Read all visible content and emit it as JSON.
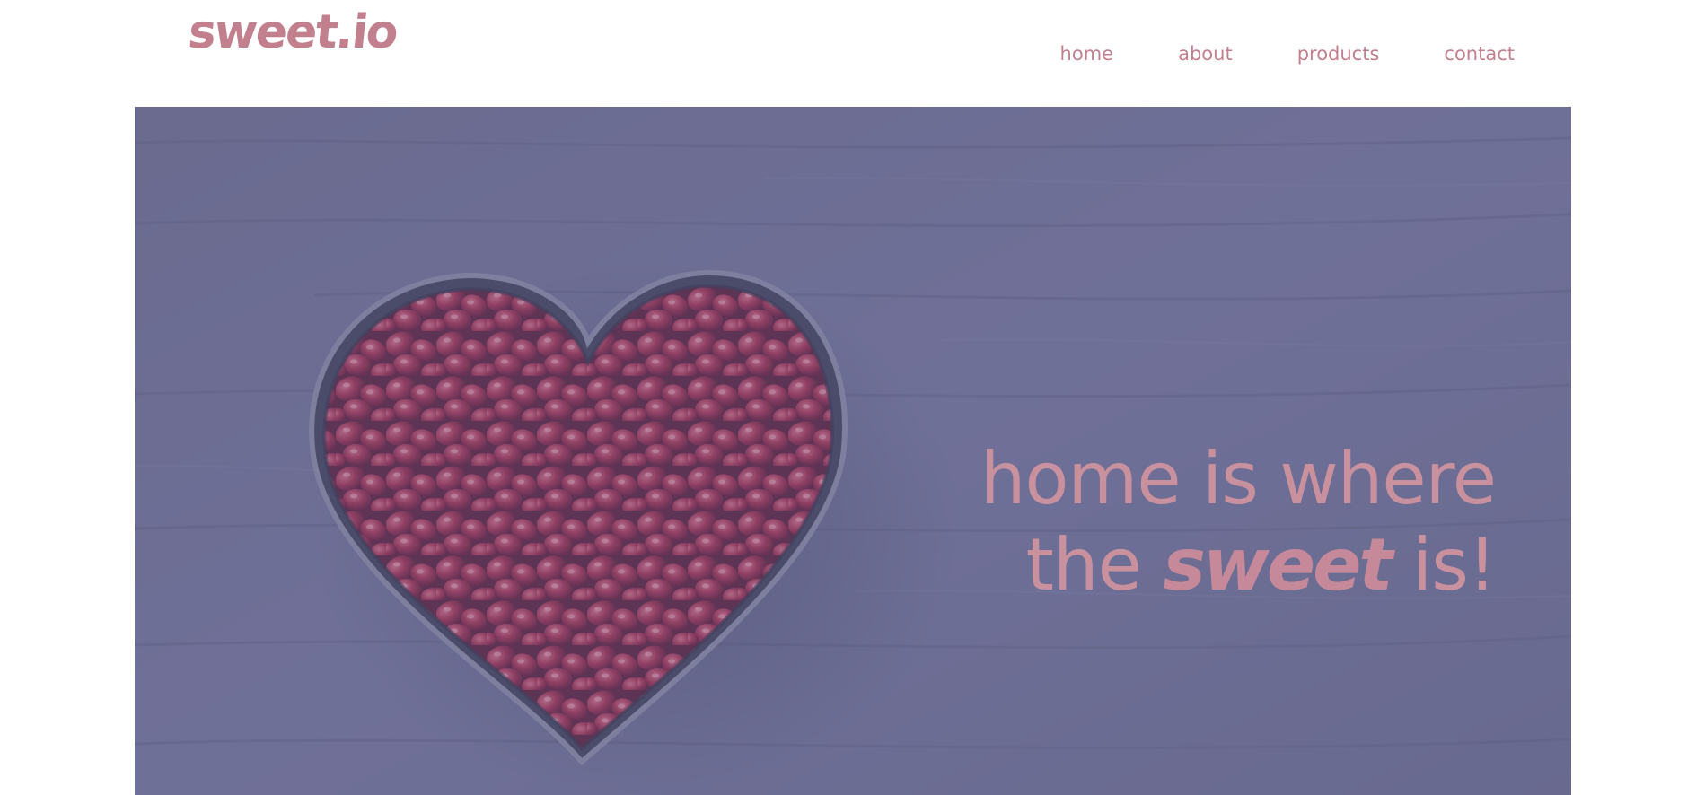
{
  "header": {
    "logo": "sweet.io",
    "nav": {
      "home": "home",
      "about": "about",
      "products": "products",
      "contact": "contact"
    }
  },
  "hero": {
    "line1": "home is where",
    "line2_prefix": "the",
    "line2_emphasis": "sweet",
    "line2_suffix": "is!",
    "image_alt": "heart-shaped bowl of pomegranate seeds on wooden table"
  },
  "colors": {
    "brand": "#c27f8e",
    "overlay": "#6f7090"
  }
}
